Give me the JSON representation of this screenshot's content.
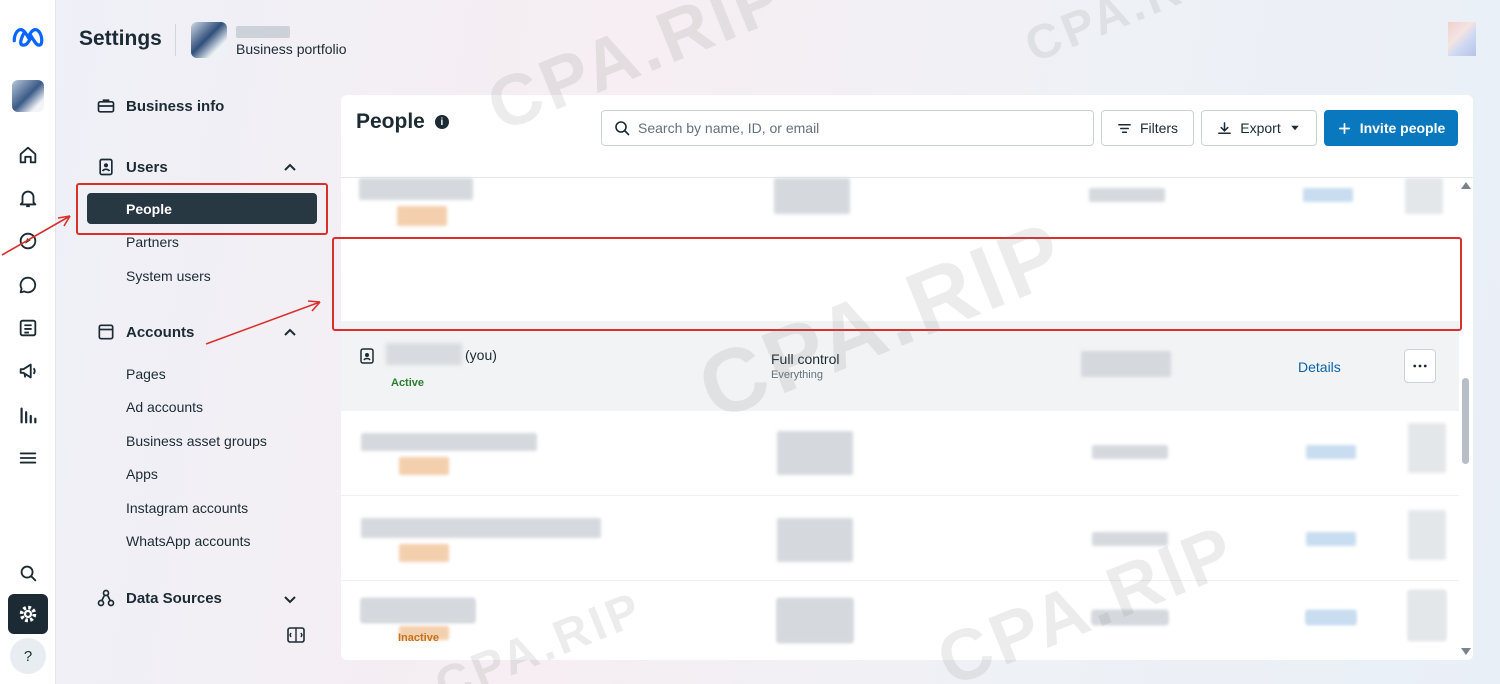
{
  "header": {
    "title": "Settings",
    "portfolio_label": "Business portfolio"
  },
  "nav": {
    "business_info": "Business info",
    "users": {
      "label": "Users",
      "items": [
        "People",
        "Partners",
        "System users"
      ]
    },
    "accounts": {
      "label": "Accounts",
      "items": [
        "Pages",
        "Ad accounts",
        "Business asset groups",
        "Apps",
        "Instagram accounts",
        "WhatsApp accounts"
      ]
    },
    "data_sources": "Data Sources"
  },
  "panel": {
    "title": "People",
    "search_placeholder": "Search by name, ID, or email",
    "filters": "Filters",
    "export": "Export",
    "invite": "Invite people"
  },
  "you_row": {
    "you_label": "(you)",
    "status": "Active",
    "access": "Full control",
    "access_sub": "Everything",
    "details": "Details"
  },
  "last_row_status": "Inactive",
  "watermark": "CPA.RIP",
  "help_label": "?",
  "colors": {
    "primary": "#0a78be",
    "active_nav": "#283843",
    "highlight": "#d9302c",
    "status_active": "#2a7d2e"
  }
}
